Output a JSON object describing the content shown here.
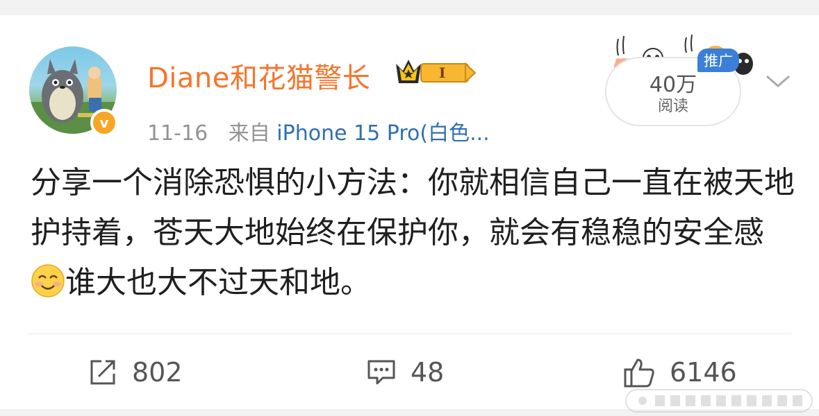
{
  "post": {
    "username": "Diane和花猫警长",
    "vip_level": "I",
    "date": "11-16",
    "source_label": "来自",
    "source_device": "iPhone 15 Pro(白色...",
    "text_part1": "分享一个消除恐惧的小方法：你就相信自己一直在被天地护持着，苍天大地始终在保护你，就会有稳稳的安全感",
    "text_part2": "谁大也大不过天和地。",
    "emoji_icon": "smile-emoji-icon"
  },
  "read": {
    "count": "40万",
    "label": "阅读",
    "promo_tag": "推广"
  },
  "actions": {
    "repost_count": "802",
    "comment_count": "48",
    "like_count": "6146"
  },
  "colors": {
    "username": "#f7742a",
    "device_link": "#2f6fb1",
    "verified": "#f5a623",
    "promo": "#3b7fd8"
  }
}
